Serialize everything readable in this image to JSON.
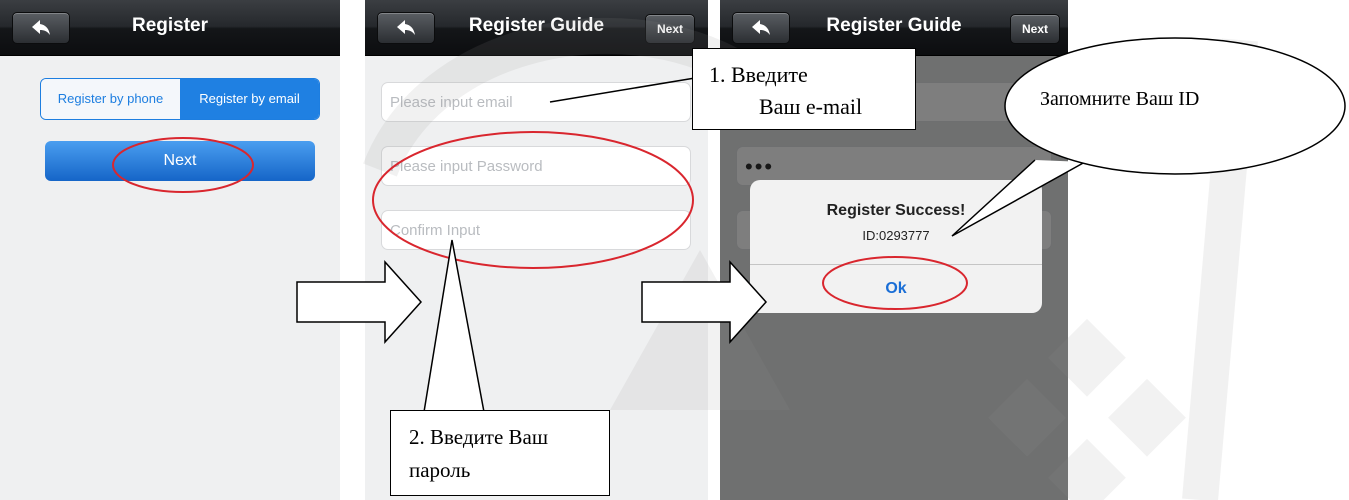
{
  "screen1": {
    "title": "Register",
    "tabs": [
      {
        "label": "Register by phone",
        "active": false
      },
      {
        "label": "Register by email",
        "active": true
      }
    ],
    "next_label": "Next"
  },
  "screen2": {
    "title": "Register Guide",
    "next_label": "Next",
    "email_placeholder": "Please input email",
    "password_placeholder": "Please input Password",
    "confirm_placeholder": "Confirm Input"
  },
  "screen3": {
    "title": "Register Guide",
    "next_label": "Next",
    "password_dots": "•••",
    "dialog": {
      "title": "Register Success!",
      "id_text": "ID:0293777",
      "ok_label": "Ok"
    }
  },
  "annotations": {
    "callout1_line1": "1.   Введите",
    "callout1_line2": "Ваш e-mail",
    "callout2_line1": "2. Введите  Ваш",
    "callout2_line2": "пароль",
    "callout3": "Запомните Ваш ID"
  },
  "colors": {
    "accent_blue": "#1f80e2",
    "annotation_red": "#d9262e",
    "nav_dark": "#1b1d20"
  }
}
